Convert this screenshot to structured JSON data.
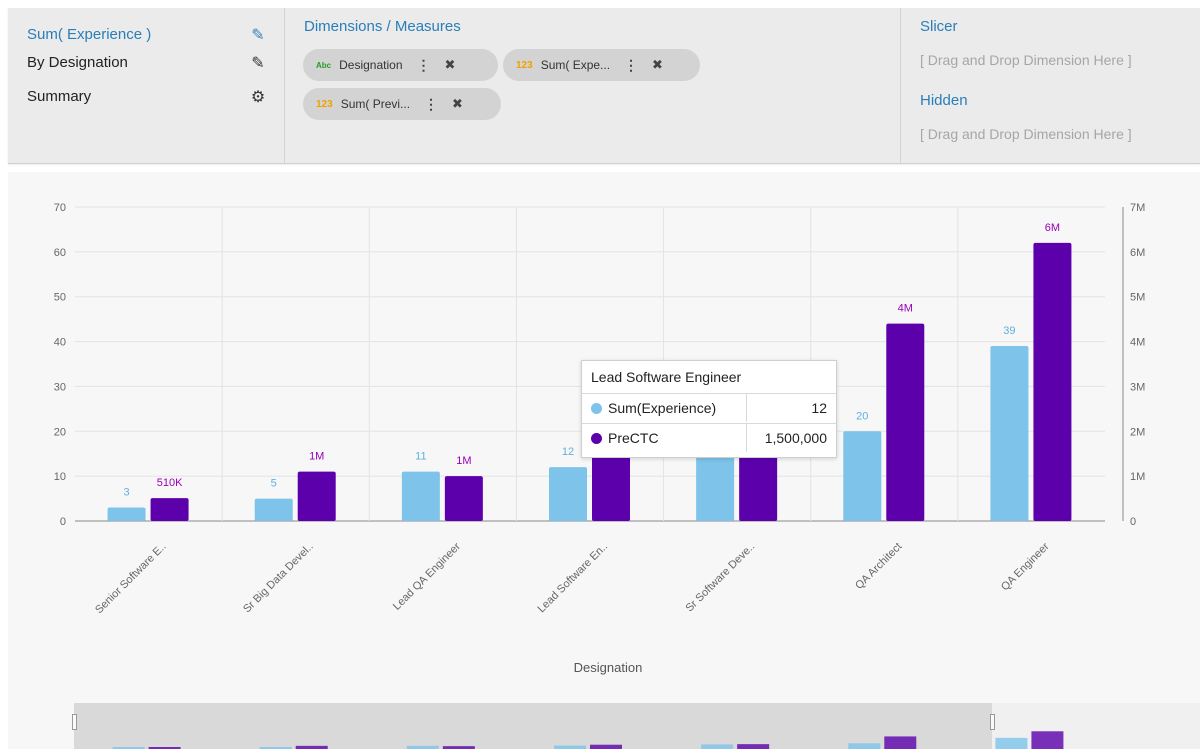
{
  "sidebar": {
    "items": [
      {
        "label": "Sum( Experience )",
        "icon": "pencil-icon"
      },
      {
        "label": "By Designation",
        "icon": "pencil-icon"
      },
      {
        "label": "Summary",
        "icon": "gear-icon"
      }
    ]
  },
  "dimensions": {
    "header": "Dimensions / Measures",
    "pills": [
      {
        "type_tag": "Abc",
        "label": "Designation"
      },
      {
        "type_tag": "123",
        "label": "Sum( Expe..."
      },
      {
        "type_tag": "123",
        "label": "Sum( Previ..."
      }
    ]
  },
  "slicer": {
    "header": "Slicer",
    "placeholder": "[ Drag and Drop Dimension Here ]"
  },
  "hidden": {
    "header": "Hidden",
    "placeholder": "[ Drag and Drop Dimension Here ]"
  },
  "colors": {
    "experience": "#7dc3ea",
    "prectc": "#5b00ab",
    "experience_label": "#5fb0e0",
    "prectc_label": "#9900b8"
  },
  "chart_data": {
    "type": "bar",
    "categories": [
      "Senior Software E..",
      "Sr Big Data Devel..",
      "Lead QA Engineer",
      "Lead Software En..",
      "Sr Software Deve..",
      "QA Architect",
      "QA Engineer"
    ],
    "series": [
      {
        "name": "Sum(Experience)",
        "axis": "left",
        "values": [
          3,
          5,
          11,
          12,
          16,
          20,
          39
        ],
        "labels": [
          "3",
          "5",
          "11",
          "12",
          "",
          "20",
          "39"
        ]
      },
      {
        "name": "PreCTC",
        "axis": "right",
        "values": [
          510000,
          1100000,
          1000000,
          1500000,
          1700000,
          4400000,
          6200000
        ],
        "labels": [
          "510K",
          "1M",
          "1M",
          "",
          "",
          "4M",
          "6M"
        ]
      }
    ],
    "xlabel": "Designation",
    "ylim_left": [
      0,
      70
    ],
    "yticks_left": [
      "0",
      "10",
      "20",
      "30",
      "40",
      "50",
      "60",
      "70"
    ],
    "ylim_right": [
      0,
      7000000
    ],
    "yticks_right": [
      "0",
      "1M",
      "2M",
      "3M",
      "4M",
      "5M",
      "6M",
      "7M"
    ],
    "grid": true
  },
  "tooltip": {
    "title": "Lead Software Engineer",
    "rows": [
      {
        "name": "Sum(Experience)",
        "value": "12"
      },
      {
        "name": "PreCTC",
        "value": "1,500,000"
      }
    ]
  }
}
